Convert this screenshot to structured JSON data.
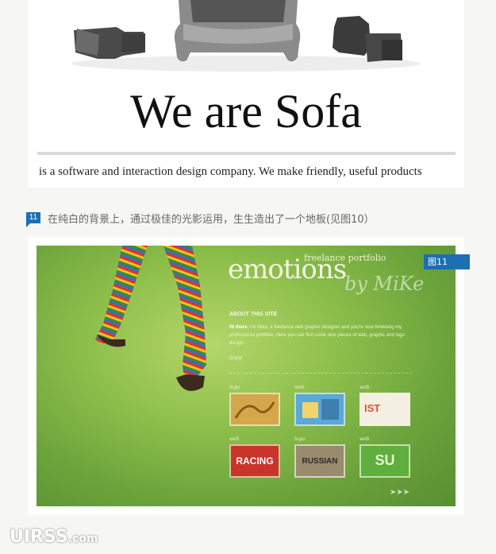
{
  "card1": {
    "title": "We are Sofa",
    "tagline": "is a software and interaction design company. We make friendly, useful products"
  },
  "caption": {
    "number": "11",
    "text": "在纯白的背景上，通过极佳的光影运用，生生造出了一个地板(见图10）"
  },
  "figure": {
    "badge": "图11",
    "site_title": "emotions",
    "site_subtitle": "freelance portfolio",
    "site_signature": "by MiKe",
    "about_title": "ABOUT THIS SITE",
    "about_lead": "Hi there.",
    "about_body": " I'm Mike, a freelance web graphic designer and you're now browsing my professional portfolio. Here you can find some nice pieces of web, graphic and logo design.",
    "enjoy": "Enjoy!",
    "thumbnails": [
      {
        "label": "logo",
        "text": ""
      },
      {
        "label": "web",
        "text": ""
      },
      {
        "label": "web",
        "text": "IST"
      },
      {
        "label": "web",
        "text": "RACING"
      },
      {
        "label": "logo",
        "text": "RUSSIAN"
      },
      {
        "label": "web",
        "text": "SU"
      }
    ]
  },
  "watermark": {
    "main": "UIRSS",
    "suffix": ".com"
  },
  "colors": {
    "accent": "#1b6fb3",
    "background": "#f6f6f4",
    "green": "#8fc04c"
  }
}
